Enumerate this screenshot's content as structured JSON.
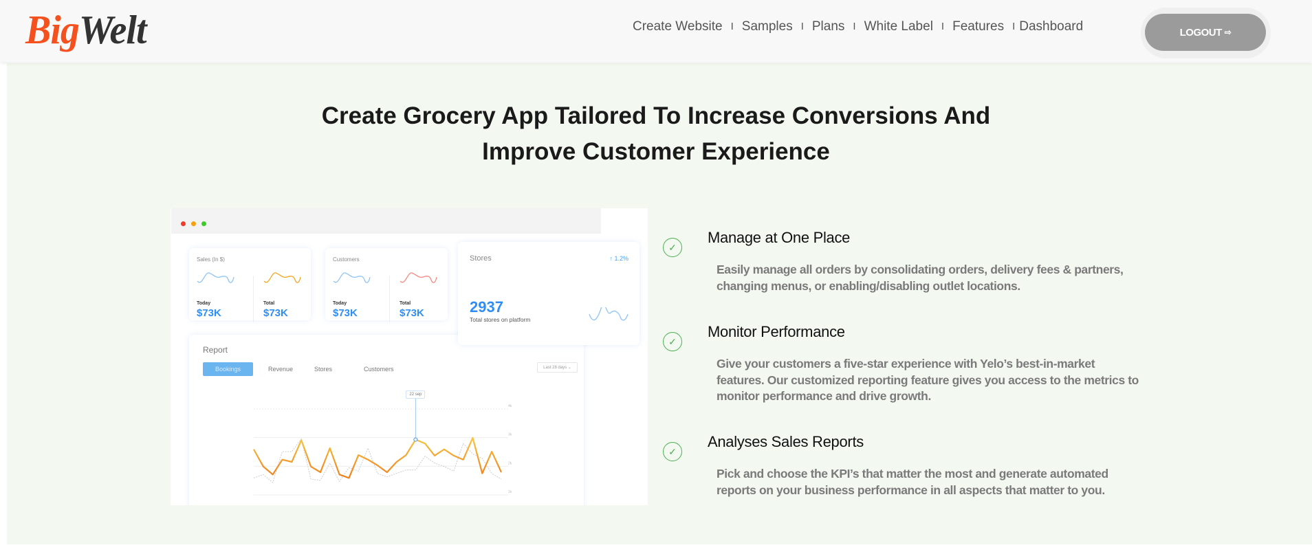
{
  "header": {
    "logo": {
      "part1": "Big",
      "part2": "Welt"
    },
    "nav": [
      "Create Website",
      "Samples",
      "Plans",
      "White Label",
      "Features",
      "Dashboard"
    ],
    "separator": "I",
    "logout_label": "LOGOUT",
    "logout_icon": "sign-out-icon"
  },
  "hero": {
    "title_line1": "Create Grocery App Tailored To Increase Conversions And",
    "title_line2": "Improve Customer Experience"
  },
  "mockup": {
    "sales_card": {
      "label": "Sales (In $)",
      "today_label": "Today",
      "today_value": "$73K",
      "total_label": "Total",
      "total_value": "$73K"
    },
    "customers_card": {
      "label": "Customers",
      "today_label": "Today",
      "today_value": "$73K",
      "total_label": "Total",
      "total_value": "$73K"
    },
    "stores_card": {
      "label": "Stores",
      "change": "↑ 1.2%",
      "value": "2937",
      "caption": "Total stores on platform"
    },
    "report": {
      "title": "Report",
      "tabs": [
        "Bookings",
        "Revenue",
        "Stores",
        "Customers"
      ],
      "active_tab": "Bookings",
      "range": "Last 28 days ⌄",
      "tooltip": "22 sep",
      "y_ticks": [
        "4k",
        "3k",
        "2k",
        "1k"
      ],
      "series_primary": [
        2.52,
        1.92,
        1.64,
        2.16,
        2.08,
        2.84,
        1.92,
        1.72,
        2.56,
        1.64,
        1.52,
        2.32,
        2.16,
        1.96,
        1.72,
        2.08,
        2.32,
        2.86,
        2.72,
        2.3,
        2.52,
        2.3,
        2.16,
        2.92,
        1.68,
        2.44,
        1.72
      ],
      "series_compare": [
        1.52,
        1.64,
        1.36,
        2.44,
        2.44,
        2.88,
        1.48,
        1.44,
        2.04,
        1.4,
        1.88,
        1.76,
        2.56,
        1.68,
        1.56,
        1.68,
        1.8,
        1.8,
        2.28,
        2.04,
        1.92,
        1.76,
        2.72,
        2.36,
        2.2,
        1.68,
        1.48
      ],
      "highlight_index": 17
    },
    "colors": {
      "blue": "#2f8ef5",
      "orange": "#f5a623",
      "red": "#f28b82"
    }
  },
  "features": [
    {
      "title": "Manage at One Place",
      "text": "Easily manage all orders by consolidating orders, delivery fees & partners, changing menus, or enabling/disabling outlet locations."
    },
    {
      "title": "Monitor Performance",
      "text": "Give your customers a five-star experience with Yelo’s best-in-market features. Our customized reporting feature gives you access to the metrics to monitor performance and drive growth."
    },
    {
      "title": "Analyses Sales Reports",
      "text": "Pick and choose the KPI’s that matter the most and generate automated reports on your business performance in all aspects that matter to you."
    }
  ],
  "colors": {
    "accent_green": "#4caf50",
    "logo_orange": "#f4511e",
    "logout_bg": "#9b9b9b",
    "section_bg": "#f3f9f1"
  }
}
